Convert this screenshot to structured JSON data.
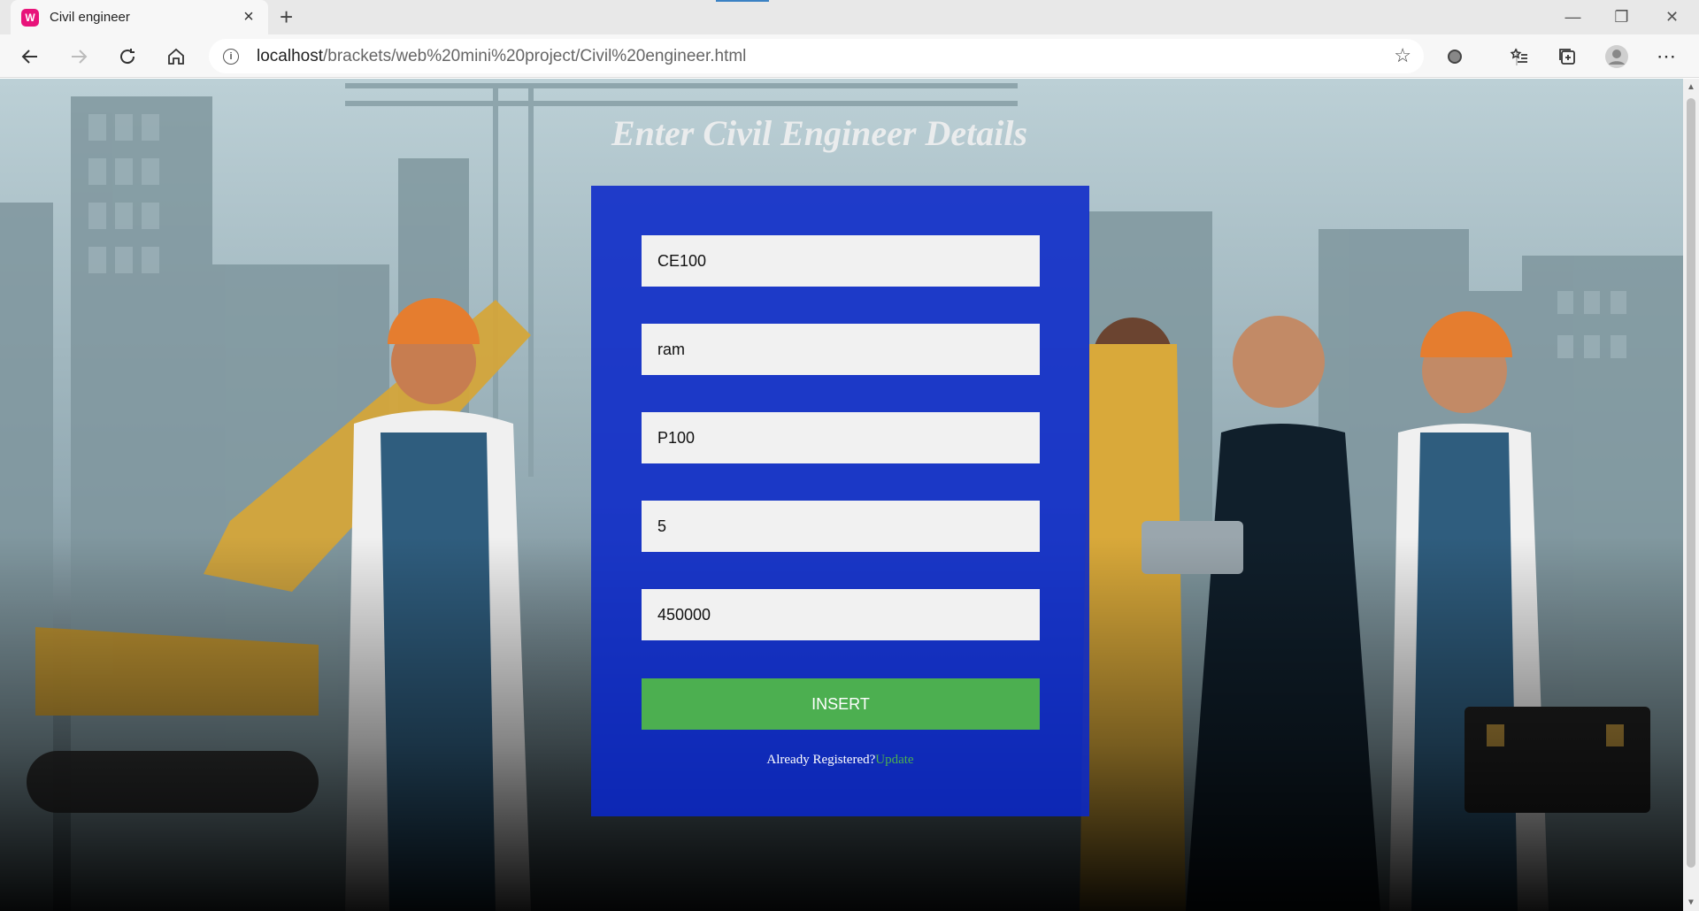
{
  "browser": {
    "tab_title": "Civil engineer",
    "favicon_letter": "W",
    "url_host": "localhost",
    "url_path": "/brackets/web%20mini%20project/Civil%20engineer.html"
  },
  "page": {
    "heading": "Enter Civil Engineer Details",
    "fields": [
      {
        "value": "CE100"
      },
      {
        "value": "ram"
      },
      {
        "value": "P100"
      },
      {
        "value": "5"
      },
      {
        "value": "450000"
      }
    ],
    "insert_label": "INSERT",
    "already_text": "Already Registered?",
    "update_link": "Update",
    "colors": {
      "panel": "#0a28c8",
      "button": "#4caf50",
      "link": "#4caf50"
    }
  }
}
